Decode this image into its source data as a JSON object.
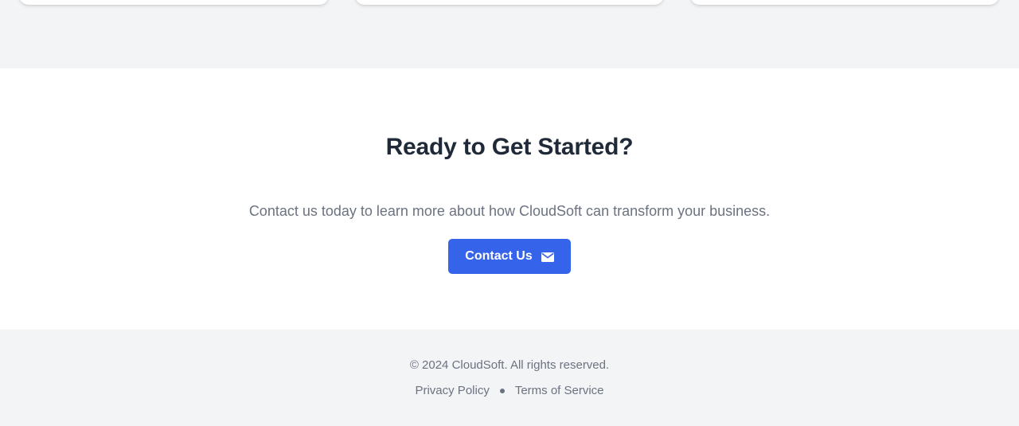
{
  "cta": {
    "title": "Ready to Get Started?",
    "text": "Contact us today to learn more about how CloudSoft can transform your business.",
    "button_label": "Contact Us",
    "button_icon": "envelope-icon",
    "accent_color": "#3563e9"
  },
  "footer": {
    "copyright": "© 2024 CloudSoft. All rights reserved.",
    "links": [
      {
        "label": "Privacy Policy"
      },
      {
        "label": "Terms of Service"
      }
    ],
    "separator_icon": "dot-separator-icon"
  }
}
